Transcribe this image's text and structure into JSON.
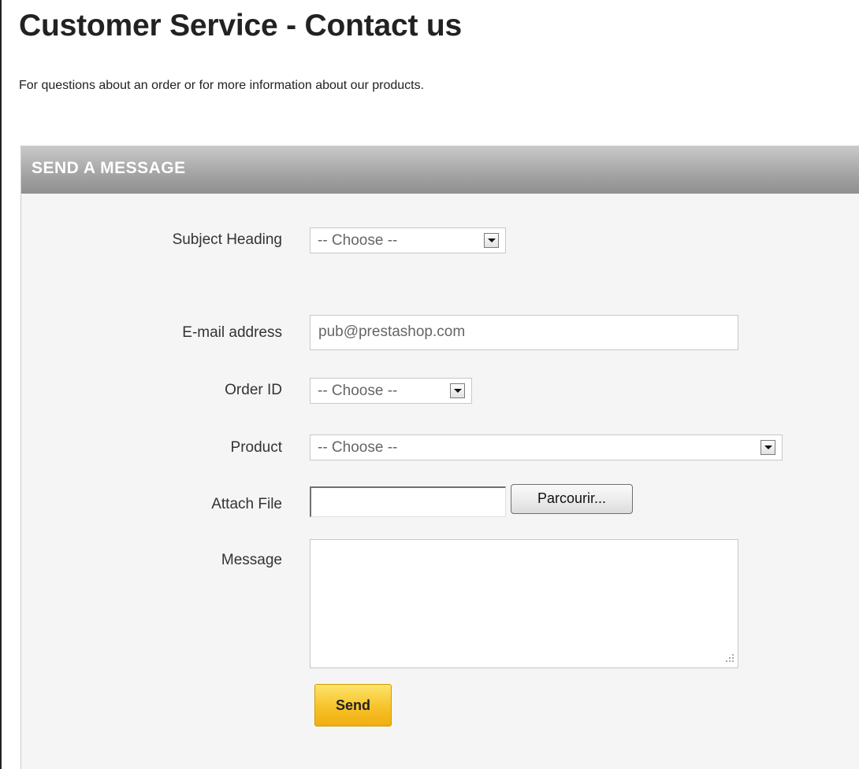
{
  "page": {
    "title": "Customer Service - Contact us",
    "intro": "For questions about an order or for more information about our products."
  },
  "form": {
    "header": "SEND A MESSAGE",
    "subject": {
      "label": "Subject Heading",
      "value": "-- Choose --"
    },
    "email": {
      "label": "E-mail address",
      "value": "pub@prestashop.com"
    },
    "order": {
      "label": "Order ID",
      "value": "-- Choose --"
    },
    "product": {
      "label": "Product",
      "value": "-- Choose --"
    },
    "attachment": {
      "label": "Attach File",
      "button_label": "Parcourir..."
    },
    "message": {
      "label": "Message",
      "value": ""
    },
    "send_label": "Send"
  },
  "colors": {
    "header_bar": "#a6a6a6",
    "panel_background": "#f5f5f5",
    "send_button": "#f7c22a"
  },
  "icons": {
    "dropdown": "chevron-down-icon",
    "resize": "resize-grip-icon"
  }
}
